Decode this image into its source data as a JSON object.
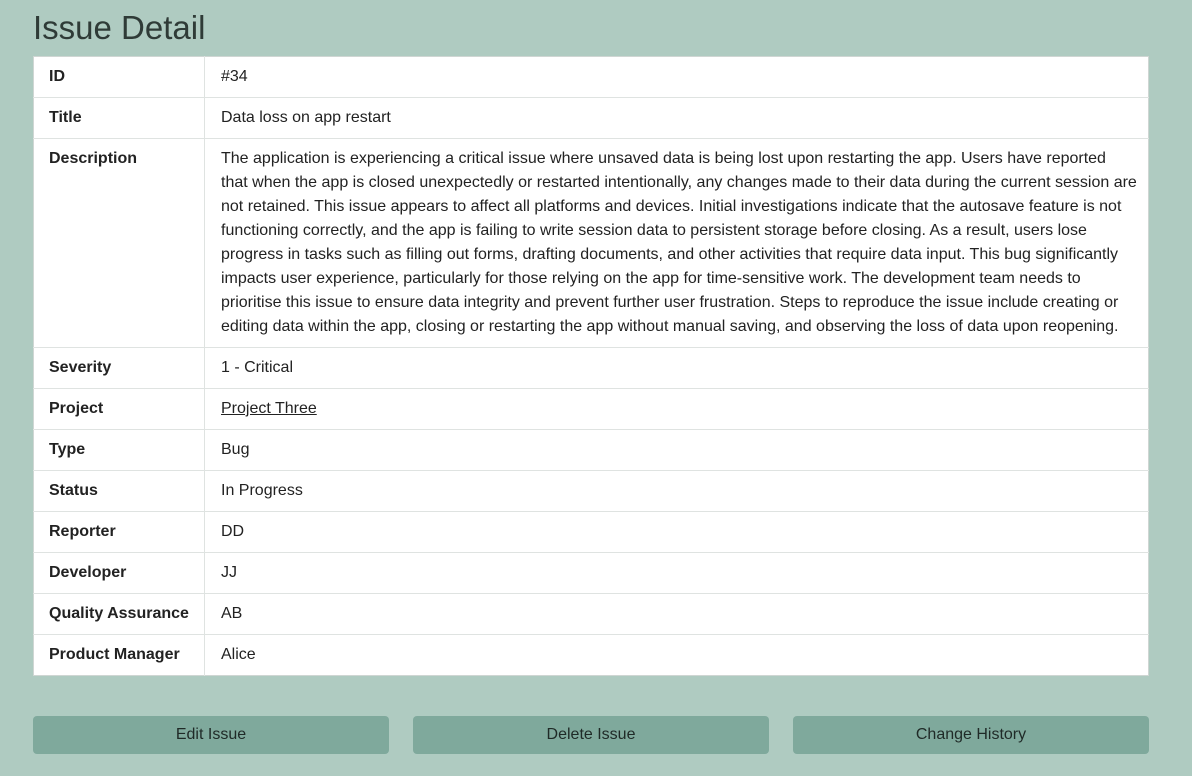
{
  "page": {
    "title": "Issue Detail"
  },
  "issue": {
    "rows": [
      {
        "label": "ID",
        "value": "#34"
      },
      {
        "label": "Title",
        "value": "Data loss on app restart"
      },
      {
        "label": "Description",
        "value": "The application is experiencing a critical issue where unsaved data is being lost upon restarting the app. Users have reported that when the app is closed unexpectedly or restarted intentionally, any changes made to their data during the current session are not retained. This issue appears to affect all platforms and devices. Initial investigations indicate that the autosave feature is not functioning correctly, and the app is failing to write session data to persistent storage before closing. As a result, users lose progress in tasks such as filling out forms, drafting documents, and other activities that require data input. This bug significantly impacts user experience, particularly for those relying on the app for time-sensitive work. The development team needs to prioritise this issue to ensure data integrity and prevent further user frustration. Steps to reproduce the issue include creating or editing data within the app, closing or restarting the app without manual saving, and observing the loss of data upon reopening."
      },
      {
        "label": "Severity",
        "value": "1 - Critical"
      },
      {
        "label": "Project",
        "value": "Project Three"
      },
      {
        "label": "Type",
        "value": "Bug"
      },
      {
        "label": "Status",
        "value": "In Progress"
      },
      {
        "label": "Reporter",
        "value": "DD"
      },
      {
        "label": "Developer",
        "value": "JJ"
      },
      {
        "label": "Quality Assurance",
        "value": "AB"
      },
      {
        "label": "Product Manager",
        "value": "Alice"
      }
    ]
  },
  "actions": {
    "edit_label": "Edit Issue",
    "delete_label": "Delete Issue",
    "history_label": "Change History"
  }
}
